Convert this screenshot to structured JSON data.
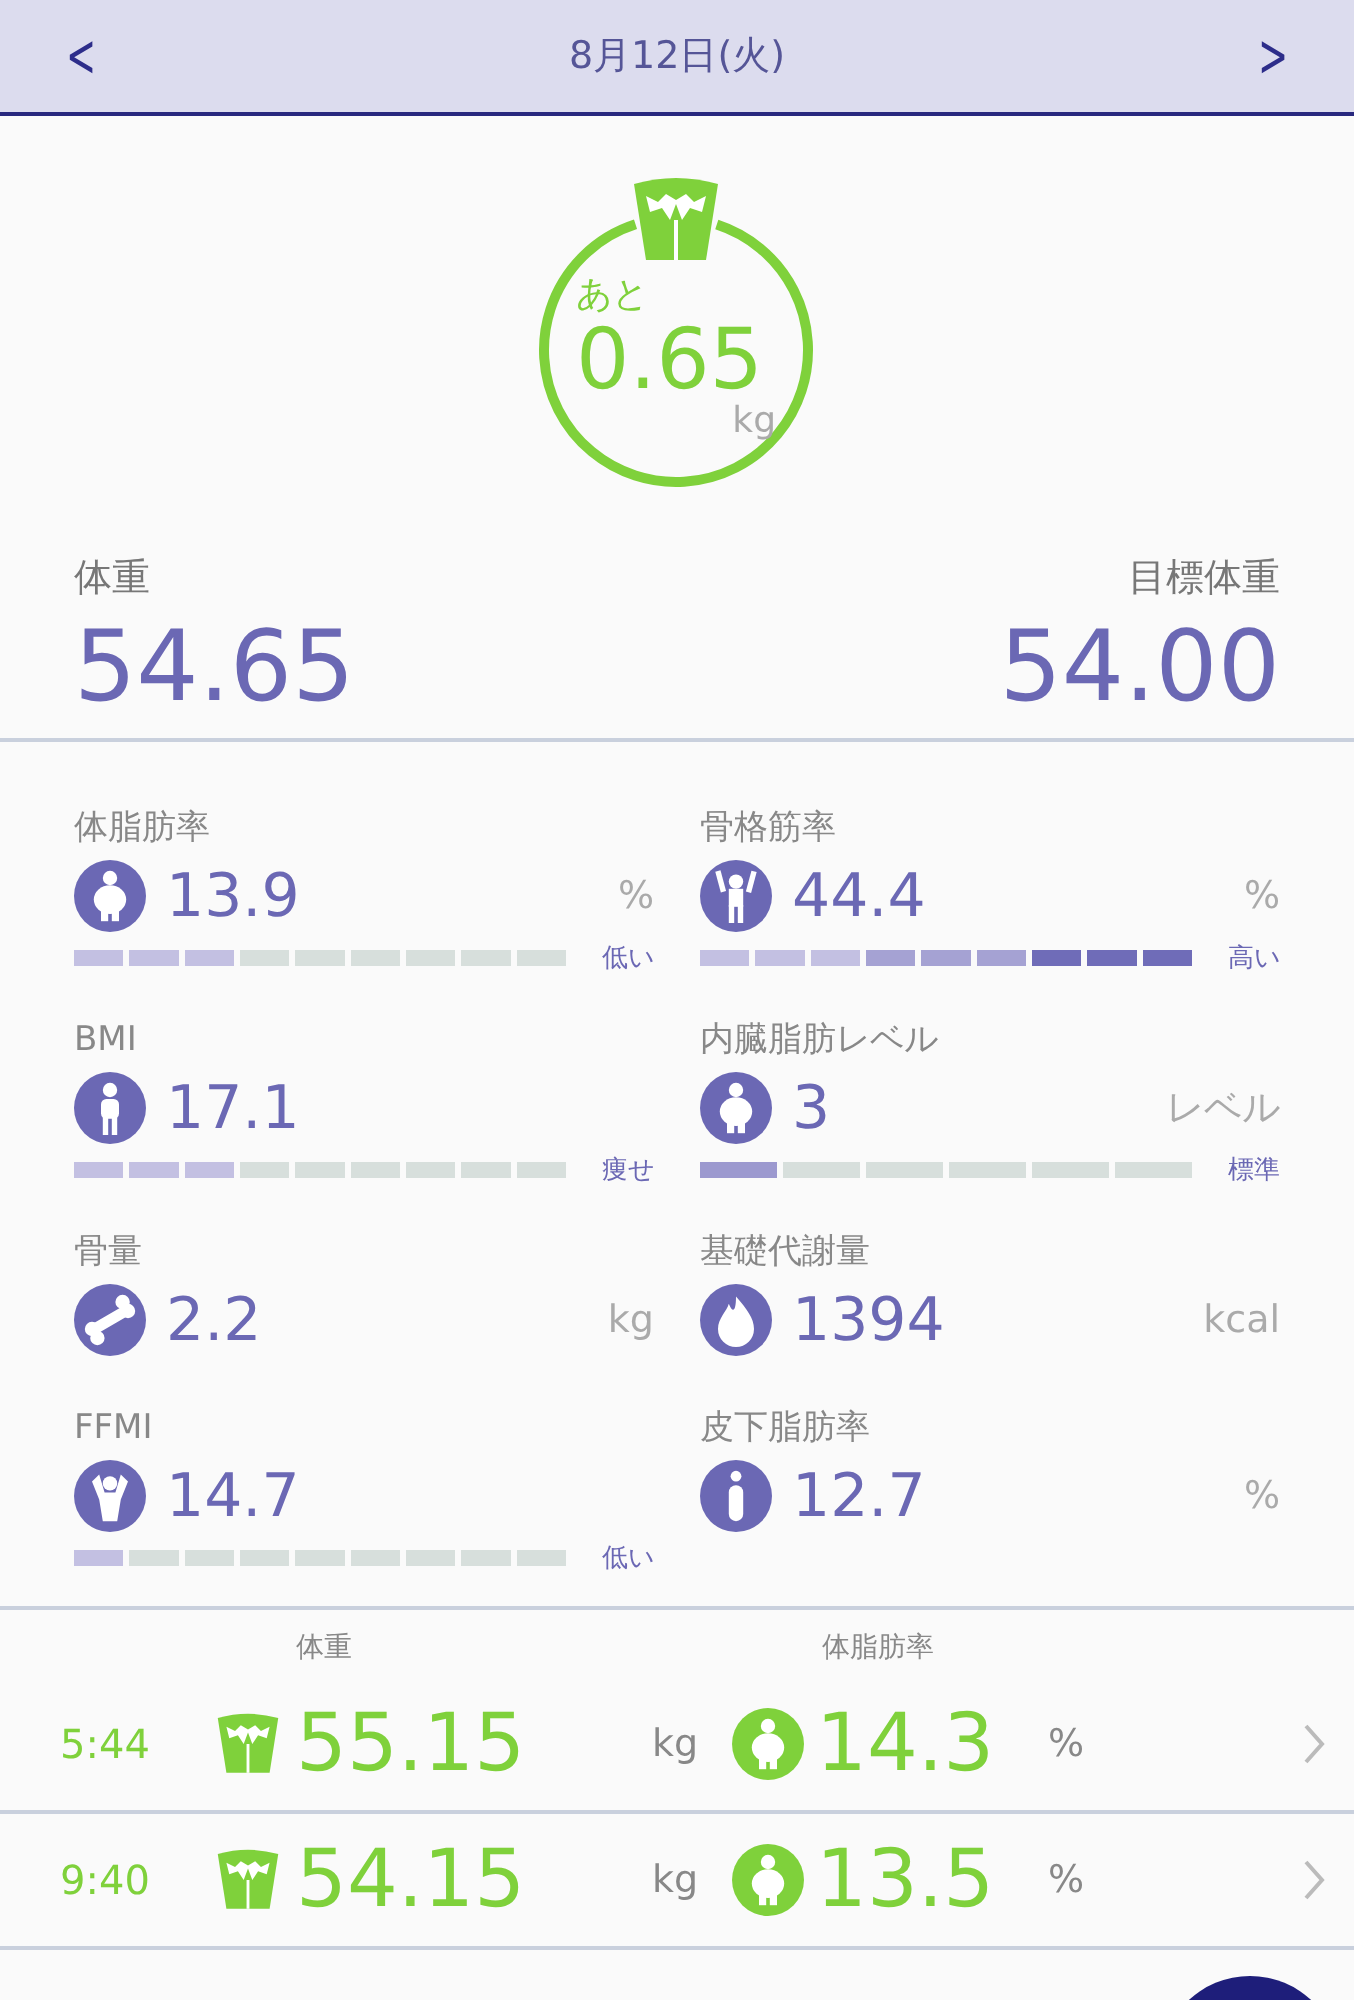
{
  "header": {
    "date": "8月12日(火)",
    "prev": "<",
    "next": ">"
  },
  "goal": {
    "prefix": "あと",
    "value": "0.65",
    "unit": "kg"
  },
  "weight": {
    "label": "体重",
    "value": "54.65"
  },
  "target": {
    "label": "目標体重",
    "value": "54.00"
  },
  "metrics": [
    {
      "label": "体脂肪率",
      "value": "13.9",
      "unit": "%",
      "bar": {
        "kind": "fine",
        "level": 0.333,
        "rating": "低い"
      }
    },
    {
      "label": "骨格筋率",
      "value": "44.4",
      "unit": "%",
      "bar": {
        "kind": "fine",
        "level": 1,
        "rating": "高い"
      }
    },
    {
      "label": "BMI",
      "value": "17.1",
      "bar": {
        "kind": "fine",
        "level": 0.333,
        "rating": "痩せ"
      }
    },
    {
      "label": "内臓脂肪レベル",
      "value": "3",
      "unit": "レベル",
      "bar": {
        "kind": "coarse",
        "level": 0.167,
        "rating": "標準"
      }
    },
    {
      "label": "骨量",
      "value": "2.2",
      "unit": "kg"
    },
    {
      "label": "基礎代謝量",
      "value": "1394",
      "unit": "kcal"
    },
    {
      "label": "FFMI",
      "value": "14.7",
      "bar": {
        "kind": "fine",
        "level": 0.111,
        "rating": "低い"
      }
    },
    {
      "label": "皮下脂肪率",
      "value": "12.7",
      "unit": "%"
    }
  ],
  "records": {
    "columns": [
      "体重",
      "体脂肪率"
    ],
    "rows": [
      {
        "time": "5:44",
        "weight": "55.15",
        "weight_unit": "kg",
        "fat": "14.3",
        "fat_unit": "%"
      },
      {
        "time": "9:40",
        "weight": "54.15",
        "weight_unit": "kg",
        "fat": "13.5",
        "fat_unit": "%"
      }
    ]
  }
}
